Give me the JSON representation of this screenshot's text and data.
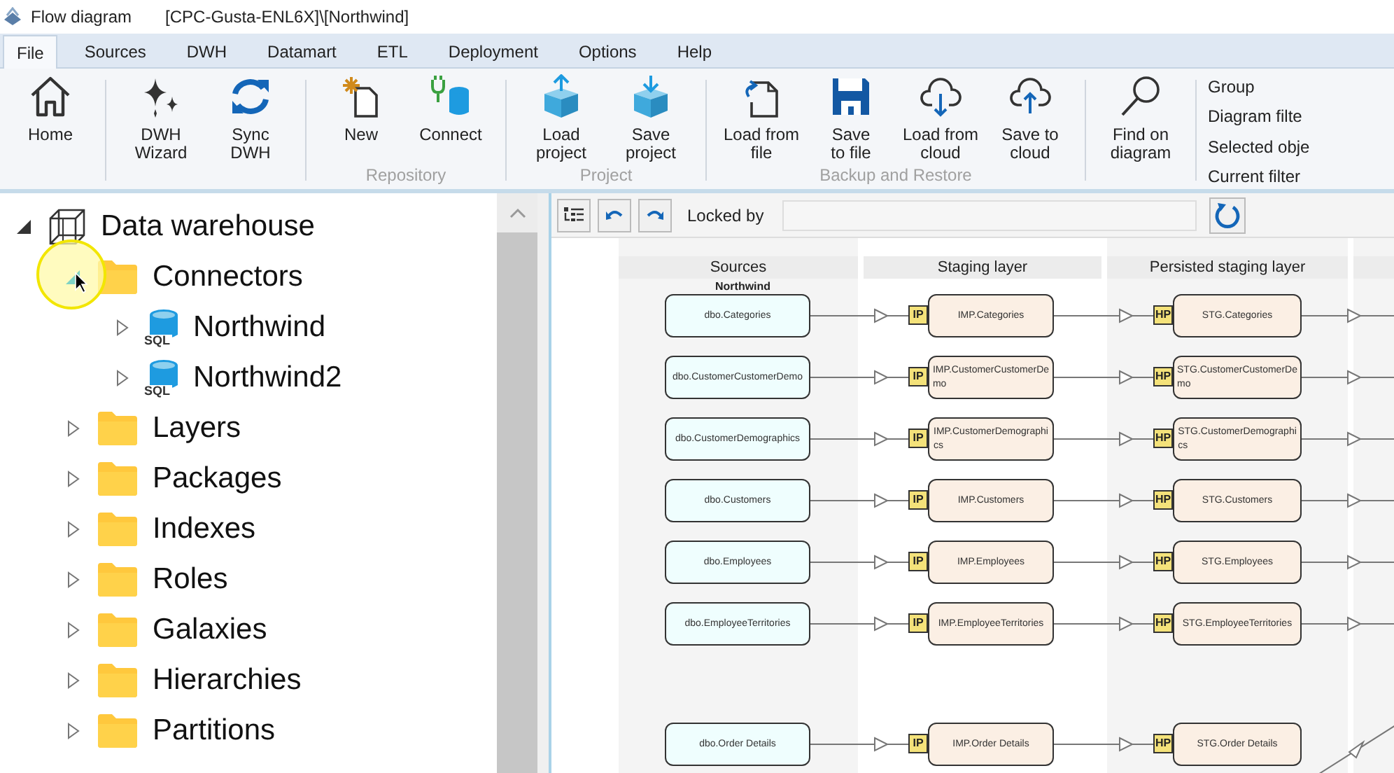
{
  "window": {
    "title": "Flow diagram",
    "path": "[CPC-Gusta-ENL6X]\\[Northwind]"
  },
  "tabs": [
    {
      "label": "File",
      "selected": true
    },
    {
      "label": "Sources",
      "selected": false
    },
    {
      "label": "DWH",
      "selected": false
    },
    {
      "label": "Datamart",
      "selected": false
    },
    {
      "label": "ETL",
      "selected": false
    },
    {
      "label": "Deployment",
      "selected": false
    },
    {
      "label": "Options",
      "selected": false
    },
    {
      "label": "Help",
      "selected": false
    }
  ],
  "ribbon": {
    "groups": [
      {
        "buttons": [
          {
            "label": "Home"
          }
        ]
      },
      {
        "buttons": [
          {
            "label": "DWH\nWizard"
          },
          {
            "label": "Sync\nDWH"
          }
        ]
      },
      {
        "label": "Repository",
        "buttons": [
          {
            "label": "New"
          },
          {
            "label": "Connect"
          }
        ]
      },
      {
        "label": "Project",
        "buttons": [
          {
            "label": "Load\nproject"
          },
          {
            "label": "Save\nproject"
          }
        ]
      },
      {
        "label": "Backup and Restore",
        "buttons": [
          {
            "label": "Load from\nfile"
          },
          {
            "label": "Save\nto file"
          },
          {
            "label": "Load from\ncloud"
          },
          {
            "label": "Save to\ncloud"
          }
        ]
      },
      {
        "buttons": [
          {
            "label": "Find on\ndiagram"
          }
        ]
      }
    ],
    "side_items": [
      "Group",
      "Diagram filte",
      "Selected obje",
      "Current filter"
    ]
  },
  "tree": [
    {
      "label": "Data warehouse",
      "kind": "warehouse",
      "expanded": true,
      "children": [
        {
          "label": "Connectors",
          "kind": "folder",
          "expanded": true,
          "hovered": true,
          "children": [
            {
              "label": "Northwind",
              "kind": "connection",
              "badge": "SQL",
              "expanded": false
            },
            {
              "label": "Northwind2",
              "kind": "connection",
              "badge": "SQL",
              "expanded": false
            }
          ]
        },
        {
          "label": "Layers",
          "kind": "folder",
          "expanded": false
        },
        {
          "label": "Packages",
          "kind": "folder",
          "expanded": false
        },
        {
          "label": "Indexes",
          "kind": "folder",
          "expanded": false
        },
        {
          "label": "Roles",
          "kind": "folder",
          "expanded": false
        },
        {
          "label": "Galaxies",
          "kind": "folder",
          "expanded": false
        },
        {
          "label": "Hierarchies",
          "kind": "folder",
          "expanded": false
        },
        {
          "label": "Partitions",
          "kind": "folder",
          "expanded": false
        }
      ]
    }
  ],
  "diagram": {
    "locked_by_label": "Locked by",
    "columns": [
      "Sources",
      "Staging layer",
      "Persisted staging layer"
    ],
    "source_group": "Northwind",
    "rows": [
      {
        "source": "dbo.Categories",
        "staging_badge": "IP",
        "staging": "IMP.Categories",
        "persisted_badge": "HP",
        "persisted": "STG.Categories",
        "branching": false
      },
      {
        "source": "dbo.CustomerCustomerDemo",
        "staging_badge": "IP",
        "staging": "IMP.CustomerCustomerDe\nmo",
        "persisted_badge": "HP",
        "persisted": "STG.CustomerCustomerDe\nmo",
        "branching": false
      },
      {
        "source": "dbo.CustomerDemographics",
        "staging_badge": "IP",
        "staging": "IMP.CustomerDemographi\ncs",
        "persisted_badge": "HP",
        "persisted": "STG.CustomerDemographi\ncs",
        "branching": false
      },
      {
        "source": "dbo.Customers",
        "staging_badge": "IP",
        "staging": "IMP.Customers",
        "persisted_badge": "HP",
        "persisted": "STG.Customers",
        "branching": false
      },
      {
        "source": "dbo.Employees",
        "staging_badge": "IP",
        "staging": "IMP.Employees",
        "persisted_badge": "HP",
        "persisted": "STG.Employees",
        "branching": false
      },
      {
        "source": "dbo.EmployeeTerritories",
        "staging_badge": "IP",
        "staging": "IMP.EmployeeTerritories",
        "persisted_badge": "HP",
        "persisted": "STG.EmployeeTerritories",
        "branching": false
      },
      {
        "source": "dbo.Order Details",
        "staging_badge": "IP",
        "staging": "IMP.Order Details",
        "persisted_badge": "HP",
        "persisted": "STG.Order Details",
        "branching": true
      }
    ]
  }
}
